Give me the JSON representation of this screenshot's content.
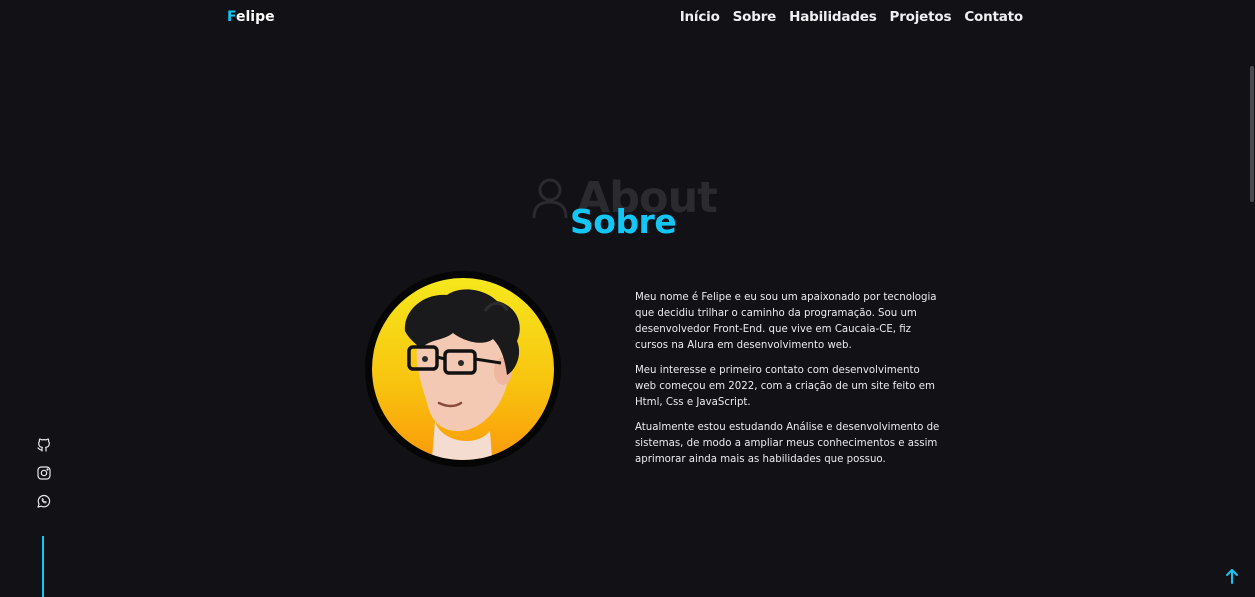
{
  "header": {
    "logo_first_letter": "F",
    "logo_rest": "elipe",
    "nav": [
      {
        "label": "Início"
      },
      {
        "label": "Sobre"
      },
      {
        "label": "Habilidades"
      },
      {
        "label": "Projetos"
      },
      {
        "label": "Contato"
      }
    ]
  },
  "section": {
    "background_title": "About",
    "title": "Sobre",
    "icon": "user-icon"
  },
  "about": {
    "paragraphs": [
      "Meu nome é Felipe e eu sou um apaixonado por tecnologia que decidiu trilhar o caminho da programação. Sou um desenvolvedor Front-End. que vive em Caucaia-CE, fiz cursos na Alura em desenvolvimento web.",
      "Meu interesse e primeiro contato com desenvolvimento web começou em 2022, com a criação de um site feito em Html, Css e JavaScript.",
      "Atualmente estou estudando Análise e desenvolvimento de sistemas, de modo a ampliar meus conhecimentos e assim aprimorar ainda mais as habilidades que possuo."
    ]
  },
  "social": [
    {
      "icon": "github-icon"
    },
    {
      "icon": "instagram-icon"
    },
    {
      "icon": "whatsapp-icon"
    }
  ],
  "colors": {
    "background": "#111116",
    "accent": "#14c6f4",
    "text": "#ececf0",
    "avatar_gradient_top": "#f5e51a",
    "avatar_gradient_bottom": "#fb9a0a"
  },
  "back_to_top_icon": "arrow-up-icon"
}
